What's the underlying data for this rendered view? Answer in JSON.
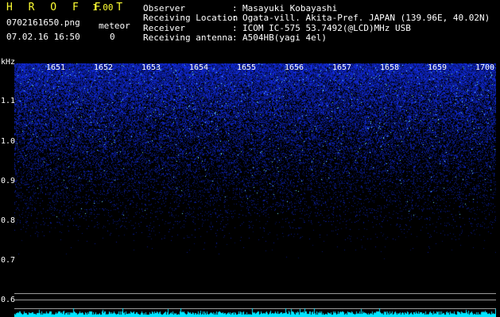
{
  "header": {
    "app_title": "H R O F F T",
    "app_version": "1.00",
    "file_name": "0702161650.png",
    "date_time": "07.02.16 16:50",
    "meteor_label": "meteor",
    "meteor_count": "0"
  },
  "metadata": [
    {
      "label": "Observer",
      "value": "Masayuki Kobayashi"
    },
    {
      "label": "Receiving Location",
      "value": "Ogata-vill. Akita-Pref. JAPAN (139.96E, 40.02N)"
    },
    {
      "label": "Receiver",
      "value": "ICOM IC-575 53.7492(@LCD)MHz USB"
    },
    {
      "label": "Receiving antenna",
      "value": "A504HB(yagi 4el)"
    }
  ],
  "spectrogram": {
    "unit_label": "kHz",
    "y_ticks": [
      "1.1",
      "1.0",
      "0.9",
      "0.8",
      "0.7",
      "0.6"
    ],
    "x_ticks": [
      "1651",
      "1652",
      "1653",
      "1654",
      "1655",
      "1656",
      "1657",
      "1658",
      "1659",
      "1700"
    ],
    "colors": {
      "background": "#000000",
      "noise_dark": "#0a0a6e",
      "noise_bright": "#2a3cff",
      "highlight": "#7ff0ff",
      "waveform": "#00e5ff",
      "divider": "#9a9a9a"
    }
  }
}
